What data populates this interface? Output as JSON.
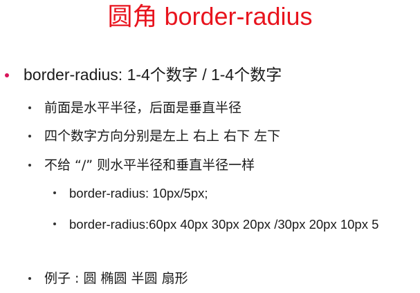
{
  "slide": {
    "title_cjk": "圆角",
    "title_en": "border-radius",
    "accent_color": "#e8141e",
    "bullet_color": "#d8145a",
    "items": [
      {
        "level": 1,
        "text": "border-radius: 1-4个数字 / 1-4个数字"
      },
      {
        "level": 2,
        "text": "前面是水平半径，后面是垂直半径"
      },
      {
        "level": 2,
        "text": "四个数字方向分别是左上  右上  右下  左下"
      },
      {
        "level": 2,
        "text": "不给 “/” 则水平半径和垂直半径一样"
      },
      {
        "level": 3,
        "text": "border-radius: 10px/5px;"
      },
      {
        "level": 3,
        "text": "border-radius:60px 40px 30px 20px /30px 20px 10px 5"
      },
      {
        "level": 2,
        "text": "例子 : 圆  椭圆  半圆  扇形"
      }
    ]
  }
}
